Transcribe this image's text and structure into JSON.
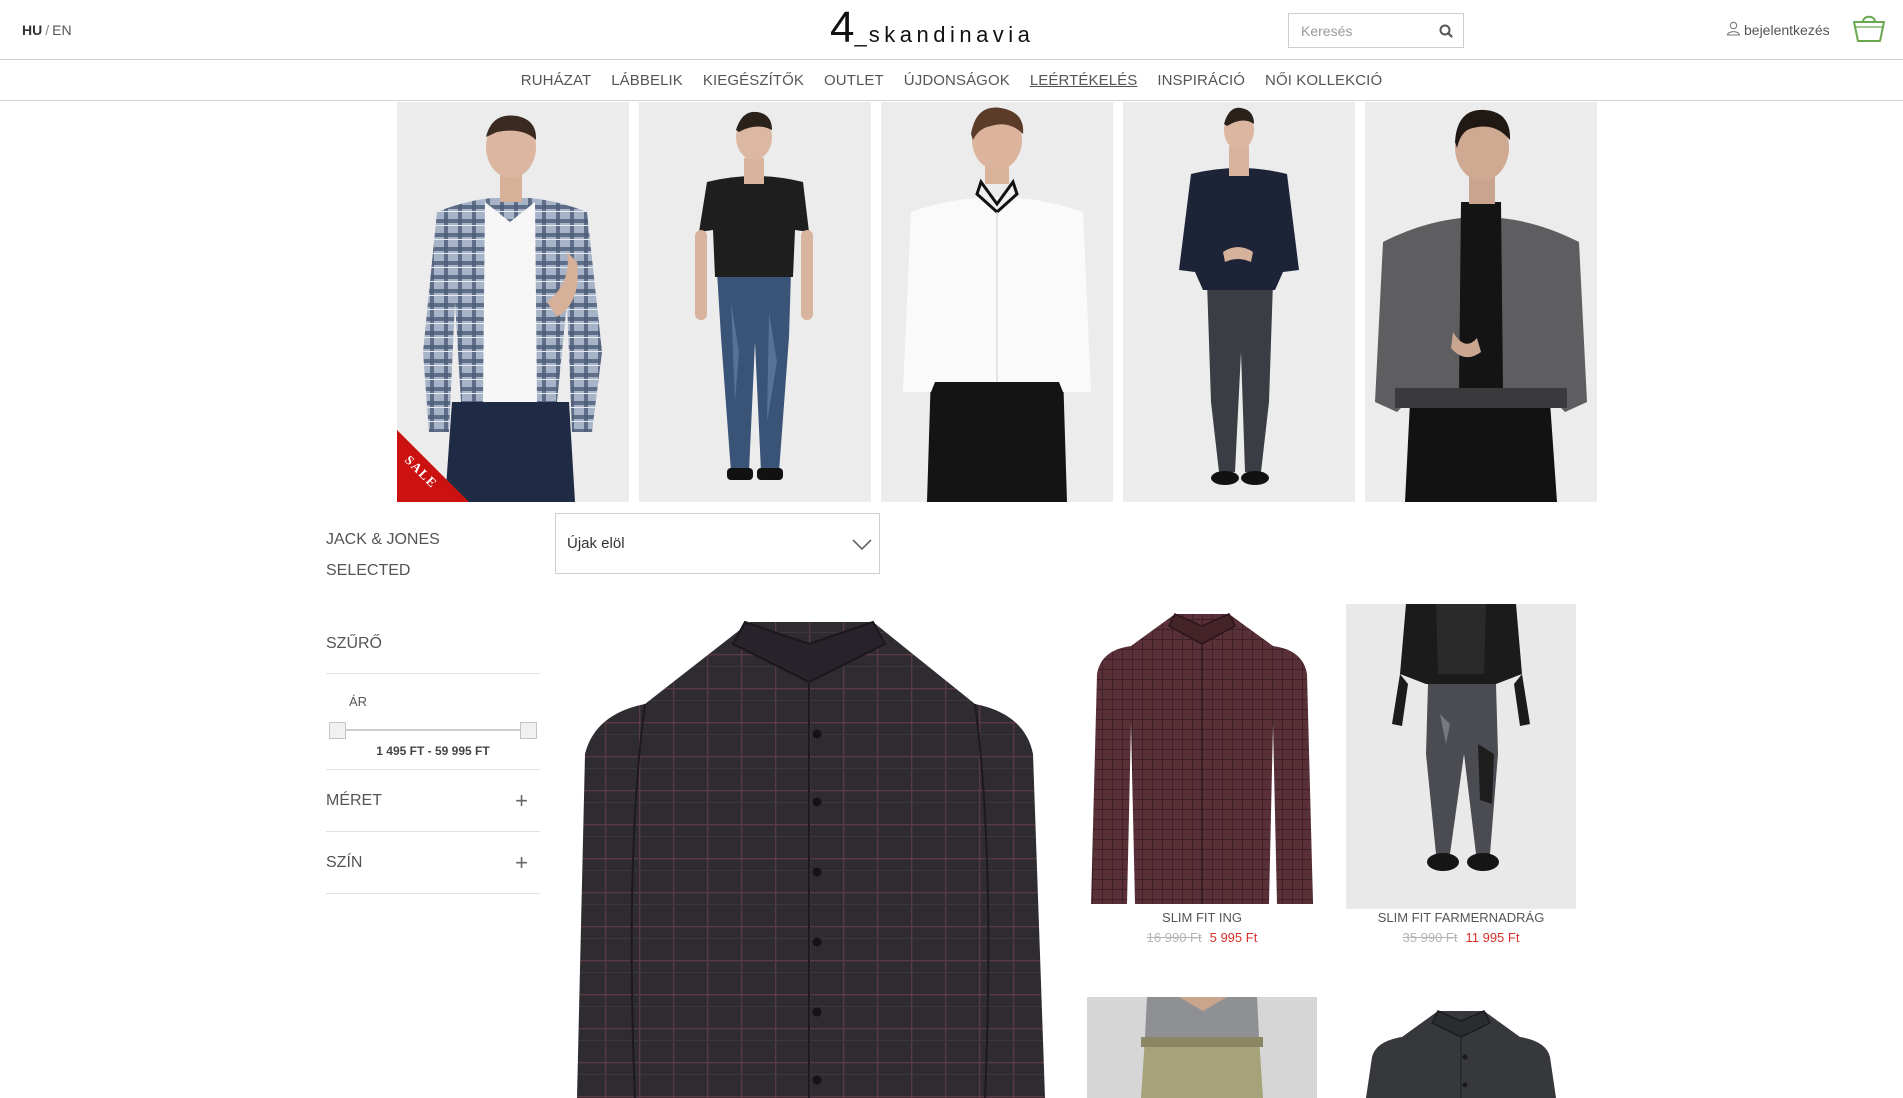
{
  "header": {
    "lang_active": "HU",
    "lang_sep": "/",
    "lang_other": "EN",
    "logo_number": "4",
    "logo_underscore": "_",
    "logo_word": "skandinavia",
    "search_placeholder": "Keresés",
    "login_label": "bejelentkezés"
  },
  "nav": {
    "items": [
      "RUHÁZAT",
      "LÁBBELIK",
      "KIEGÉSZÍTŐK",
      "OUTLET",
      "ÚJDONSÁGOK",
      "LEÉRTÉKELÉS",
      "INSPIRÁCIÓ",
      "NŐI KOLLEKCIÓ"
    ],
    "current": "LEÉRTÉKELÉS"
  },
  "hero": {
    "sale_label": "SALE"
  },
  "sidebar": {
    "brands": [
      "JACK & JONES",
      "SELECTED"
    ],
    "filter_title": "SZŰRŐ",
    "price_label": "ÁR",
    "price_range": "1 495 FT - 59 995 FT",
    "size_label": "MÉRET",
    "color_label": "SZÍN",
    "expand_symbol": "+"
  },
  "sort": {
    "selected": "Újak elöl"
  },
  "products": [
    {
      "name": "SLIM FIT ING",
      "old_price": "16 990 Ft",
      "new_price": "5 995 Ft"
    },
    {
      "name": "SLIM FIT FARMERNADRÁG",
      "old_price": "35 990 Ft",
      "new_price": "11 995 Ft"
    }
  ],
  "colors": {
    "sale_red": "#cc1111",
    "price_red": "#d9302a",
    "basket_green": "#6aa84f",
    "text_gray": "#555555"
  },
  "icons": {
    "search": "search-icon",
    "user": "user-icon",
    "basket": "basket-icon",
    "chevron": "chevron-down-icon"
  }
}
